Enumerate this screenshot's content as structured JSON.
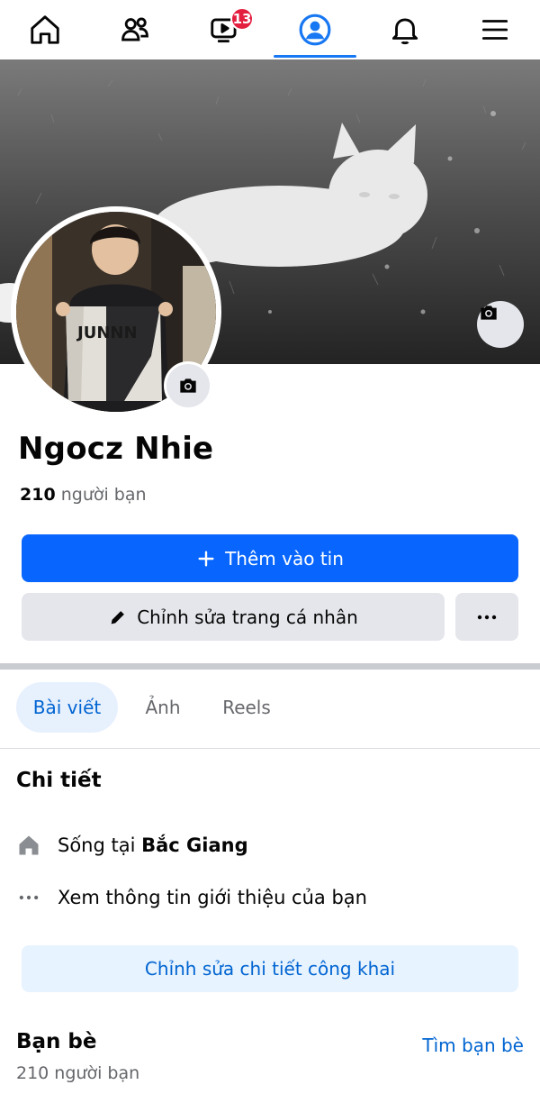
{
  "nav": {
    "items": [
      {
        "name": "home",
        "icon": "home-icon"
      },
      {
        "name": "friends",
        "icon": "friends-icon"
      },
      {
        "name": "video",
        "icon": "video-icon",
        "badge": "13"
      },
      {
        "name": "profile",
        "icon": "profile-icon",
        "active": true
      },
      {
        "name": "notifications",
        "icon": "bell-icon"
      },
      {
        "name": "menu",
        "icon": "menu-icon"
      }
    ],
    "video_badge": "13"
  },
  "profile": {
    "name": "Ngocz Nhie",
    "friends_count": "210",
    "friends_label": "người bạn",
    "jersey_text": "JUNNN"
  },
  "actions": {
    "add_story": "Thêm vào tin",
    "edit_profile": "Chỉnh sửa trang cá nhân",
    "more": "···"
  },
  "tabs": [
    {
      "label": "Bài viết",
      "active": true
    },
    {
      "label": "Ảnh",
      "active": false
    },
    {
      "label": "Reels",
      "active": false
    }
  ],
  "details": {
    "title": "Chi tiết",
    "lives_in_prefix": "Sống tại",
    "lives_in_place": "Bắc Giang",
    "see_about": "Xem thông tin giới thiệu của bạn",
    "edit_public_details": "Chỉnh sửa chi tiết công khai"
  },
  "friends": {
    "title": "Bạn bè",
    "find_friends": "Tìm bạn bè",
    "count_text": "210 người bạn"
  },
  "colors": {
    "accent": "#0866ff",
    "link": "#0064d1",
    "badge": "#e41e3f",
    "button_secondary": "#e4e6eb"
  }
}
